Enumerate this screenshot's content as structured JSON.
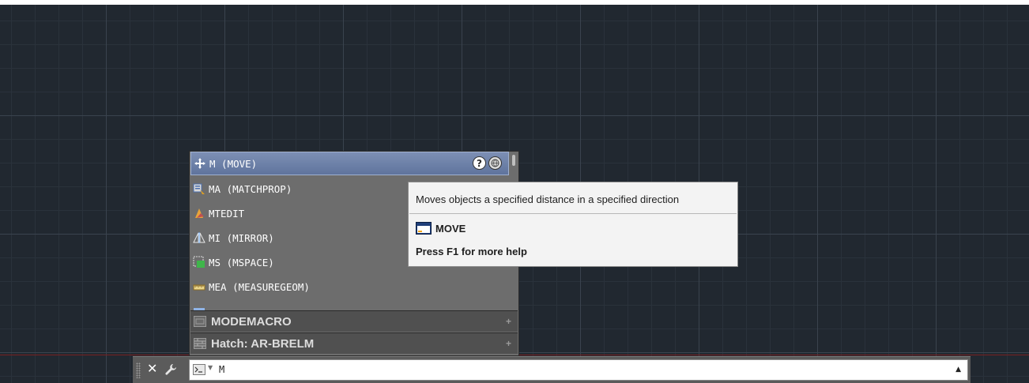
{
  "suggestions": [
    {
      "label": "M (MOVE)",
      "icon": "move-icon",
      "selected": true
    },
    {
      "label": "MA (MATCHPROP)",
      "icon": "matchprop-icon"
    },
    {
      "label": "MTEDIT",
      "icon": "mtedit-icon"
    },
    {
      "label": "MI (MIRROR)",
      "icon": "mirror-icon"
    },
    {
      "label": "MS (MSPACE)",
      "icon": "mspace-icon"
    },
    {
      "label": "MEA (MEASUREGEOM)",
      "icon": "measuregeom-icon"
    }
  ],
  "categories": [
    {
      "label": "MODEMACRO",
      "icon": "system-variable-icon"
    },
    {
      "label": "Hatch: AR-BRELM",
      "icon": "hatch-icon"
    }
  ],
  "help_icons": {
    "help": "?",
    "online": "globe-icon"
  },
  "tooltip": {
    "description": "Moves objects a specified distance in a specified direction",
    "command": "MOVE",
    "help_hint": "Press F1 for more help"
  },
  "command_line": {
    "close_symbol": "✕",
    "input_value": "M"
  },
  "colors": {
    "canvas": "#212830",
    "selected_row": "#6f82aa",
    "list_bg": "#6d6d6d",
    "tooltip_bg": "#f3f3f3"
  }
}
